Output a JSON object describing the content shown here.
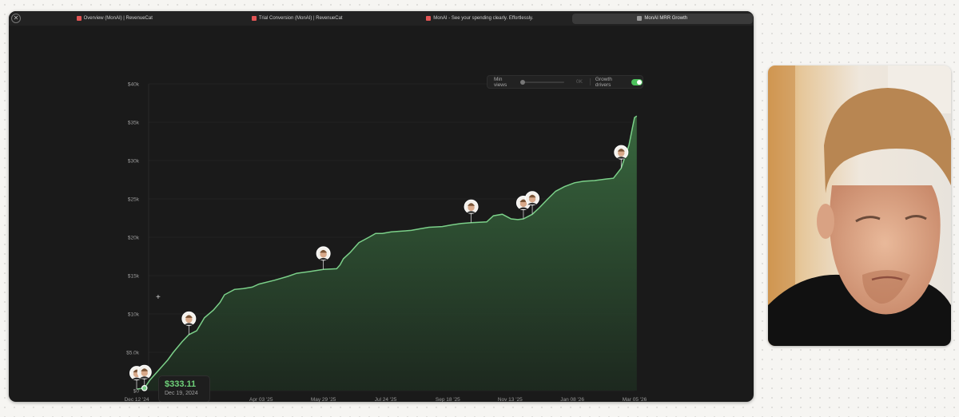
{
  "tabs": [
    {
      "label": "Overview (MonAI) | RevenueCat",
      "active": false
    },
    {
      "label": "Trial Conversion (MonAI) | RevenueCat",
      "active": false
    },
    {
      "label": "MonAI - See your spending clearly. Effortlessly.",
      "active": false
    },
    {
      "label": "MonAI MRR Growth",
      "active": true
    }
  ],
  "controls": {
    "min_views_label": "Min views",
    "min_views_value": "0K",
    "growth_drivers_label": "Growth drivers",
    "growth_drivers_on": true
  },
  "tooltip": {
    "value": "$333.11",
    "date": "Dec 19, 2024"
  },
  "colors": {
    "accent": "#4cc15c",
    "line": "#7bd089",
    "background": "#1a1a1a"
  },
  "chart_data": {
    "type": "area",
    "title": "",
    "xlabel": "",
    "ylabel": "",
    "ylim": [
      0,
      40000
    ],
    "y_ticks": [
      "$0",
      "$5.0k",
      "$10k",
      "$15k",
      "$20k",
      "$25k",
      "$30k",
      "$35k",
      "$40k"
    ],
    "y_tick_values": [
      0,
      5000,
      10000,
      15000,
      20000,
      25000,
      30000,
      35000,
      40000
    ],
    "x_ticks": [
      "Dec 12 '24",
      "Feb 05 '25",
      "Apr 03 '25",
      "May 29 '25",
      "Jul 24 '25",
      "Sep 18 '25",
      "Nov 13 '25",
      "Jan 08 '26",
      "Mar 05 '26"
    ],
    "x_tick_dates": [
      "2024-12-12",
      "2025-02-05",
      "2025-04-03",
      "2025-05-29",
      "2025-07-24",
      "2025-09-18",
      "2025-11-13",
      "2026-01-08",
      "2026-03-05"
    ],
    "grid": true,
    "series": [
      {
        "x": [
          "2024-12-12",
          "2024-12-19",
          "2024-12-24",
          "2025-01-01",
          "2025-01-09",
          "2025-01-14",
          "2025-01-22",
          "2025-01-28",
          "2025-02-04",
          "2025-02-11",
          "2025-02-19",
          "2025-02-25",
          "2025-03-01",
          "2025-03-10",
          "2025-03-18",
          "2025-03-26",
          "2025-04-01",
          "2025-04-15",
          "2025-04-27",
          "2025-05-05",
          "2025-05-15",
          "2025-05-29",
          "2025-06-10",
          "2025-06-13",
          "2025-06-16",
          "2025-06-22",
          "2025-06-30",
          "2025-07-09",
          "2025-07-15",
          "2025-07-21",
          "2025-07-29",
          "2025-08-08",
          "2025-08-16",
          "2025-08-24",
          "2025-09-01",
          "2025-09-13",
          "2025-09-21",
          "2025-09-30",
          "2025-10-09",
          "2025-10-23",
          "2025-10-29",
          "2025-11-06",
          "2025-11-14",
          "2025-11-20",
          "2025-11-25",
          "2025-12-03",
          "2025-12-09",
          "2025-12-17",
          "2025-12-24",
          "2026-01-01",
          "2026-01-10",
          "2026-01-18",
          "2026-01-28",
          "2026-02-08",
          "2026-02-14",
          "2026-02-21",
          "2026-02-28",
          "2026-03-03",
          "2026-03-05",
          "2026-03-07"
        ],
        "y": [
          200,
          333,
          1400,
          2700,
          4000,
          5000,
          6400,
          7300,
          7800,
          9500,
          10500,
          11500,
          12500,
          13200,
          13300,
          13500,
          13900,
          14400,
          14900,
          15300,
          15500,
          15800,
          15900,
          16400,
          17200,
          18000,
          19300,
          20000,
          20500,
          20500,
          20700,
          20800,
          20900,
          21100,
          21300,
          21400,
          21600,
          21800,
          21900,
          22000,
          22800,
          23000,
          22400,
          22300,
          22400,
          23000,
          23800,
          25000,
          26000,
          26600,
          27100,
          27300,
          27400,
          27600,
          27700,
          29000,
          32000,
          34200,
          35600,
          35800
        ]
      }
    ],
    "growth_driver_dates": [
      "2024-12-12",
      "2024-12-19",
      "2025-01-28",
      "2025-05-29",
      "2025-10-09",
      "2025-11-25",
      "2025-12-03",
      "2026-02-21"
    ]
  }
}
